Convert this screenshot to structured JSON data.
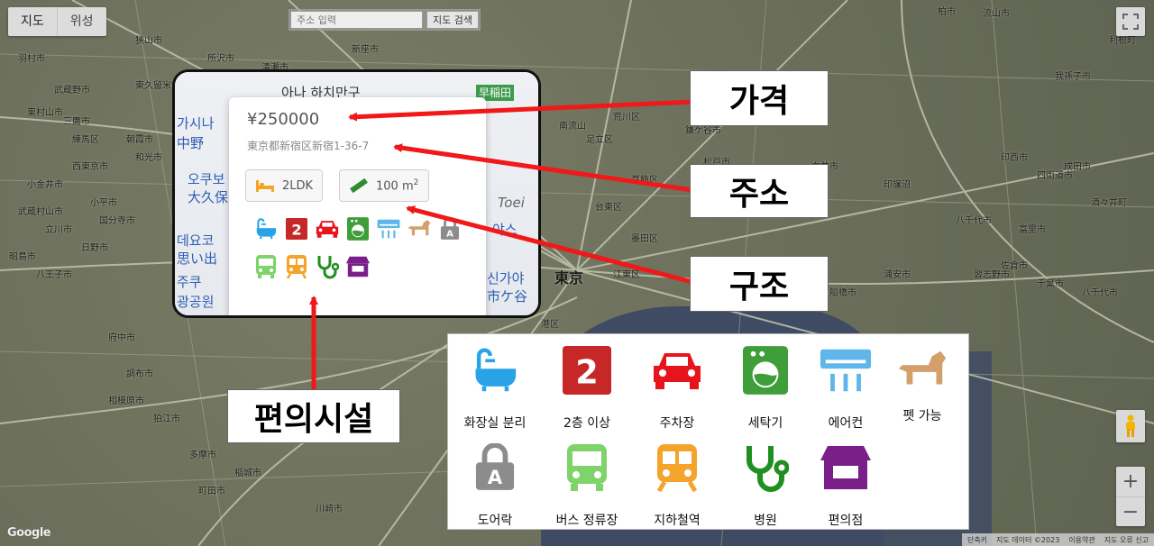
{
  "map_controls": {
    "type_tabs": [
      "지도",
      "위성"
    ],
    "search_placeholder": "주소 입력",
    "search_button": "지도 검색",
    "zoom_in": "+",
    "zoom_out": "−",
    "google_logo": "Google",
    "attribution": [
      "단축키",
      "지도 데이터 ©2023",
      "이용약관",
      "지도 오류 신고"
    ]
  },
  "map_labels": [
    "柏市",
    "南流山",
    "八千代市",
    "羽村市",
    "狭山市",
    "所沢市",
    "清瀬市",
    "新座市",
    "志木市",
    "東久留米市",
    "東村山市",
    "朝霞市",
    "和光市",
    "板橋区",
    "練馬区",
    "西東京市",
    "小平市",
    "武蔵村山市",
    "立川市",
    "昭島市",
    "日野市",
    "国分寺市",
    "小金井市",
    "三鷹市",
    "武蔵野市",
    "府中市",
    "調布市",
    "狛江市",
    "八王子市",
    "相模原市",
    "町田市",
    "多摩市",
    "稲城市",
    "川崎市",
    "足立区",
    "葛飾区",
    "江戸川区",
    "市川市",
    "船橋市",
    "浦安市",
    "習志野市",
    "千葉市",
    "八千代市",
    "佐倉市",
    "四街道市",
    "成田市",
    "印旛沼",
    "白井市",
    "鎌ケ谷市",
    "松戸市",
    "流山市",
    "我孫子市",
    "利根町",
    "印西市",
    "酒々井町",
    "富里市",
    "東京",
    "江東区",
    "港区",
    "台東区",
    "墨田区",
    "荒川区"
  ],
  "listing": {
    "price": "¥250000",
    "address": "東京都新宿区新宿1-36-7",
    "layout": "2LDK",
    "area": "100 m",
    "area_sup": "2",
    "card_map_labels": [
      "아나 하치만구",
      "早稲田",
      "가시나",
      "中野",
      "오쿠보",
      "大久保",
      "데요코",
      "思い出",
      "주쿠",
      "광공원",
      "신가야",
      "市ケ谷",
      "야스",
      "Toei"
    ]
  },
  "callouts": {
    "price": "가격",
    "address": "주소",
    "structure": "구조",
    "amenities": "편의시설"
  },
  "legend": {
    "items": [
      {
        "label": "화장실 분리",
        "icon": "bath-icon"
      },
      {
        "label": "2층 이상",
        "icon": "floor-2-icon"
      },
      {
        "label": "주차장",
        "icon": "car-icon"
      },
      {
        "label": "세탁기",
        "icon": "washing-machine-icon"
      },
      {
        "label": "에어컨",
        "icon": "air-conditioner-icon"
      },
      {
        "label": "펫 가능",
        "icon": "pet-dog-icon"
      },
      {
        "label": "도어락",
        "icon": "door-lock-icon"
      },
      {
        "label": "버스 정류장",
        "icon": "bus-icon"
      },
      {
        "label": "지하철역",
        "icon": "subway-icon"
      },
      {
        "label": "병원",
        "icon": "hospital-stethoscope-icon"
      },
      {
        "label": "편의점",
        "icon": "convenience-store-icon"
      }
    ]
  },
  "colors": {
    "bath": "#29a3e8",
    "floor2": "#c62828",
    "car": "#e8141c",
    "washer": "#3f9e3a",
    "aircon": "#5eb6ea",
    "dog": "#d4a06a",
    "lock": "#8c8c8c",
    "bus": "#7ed36b",
    "subway": "#f4a42a",
    "stethoscope": "#1f8f1f",
    "store": "#7a1f8a",
    "arrow": "#f01818"
  }
}
